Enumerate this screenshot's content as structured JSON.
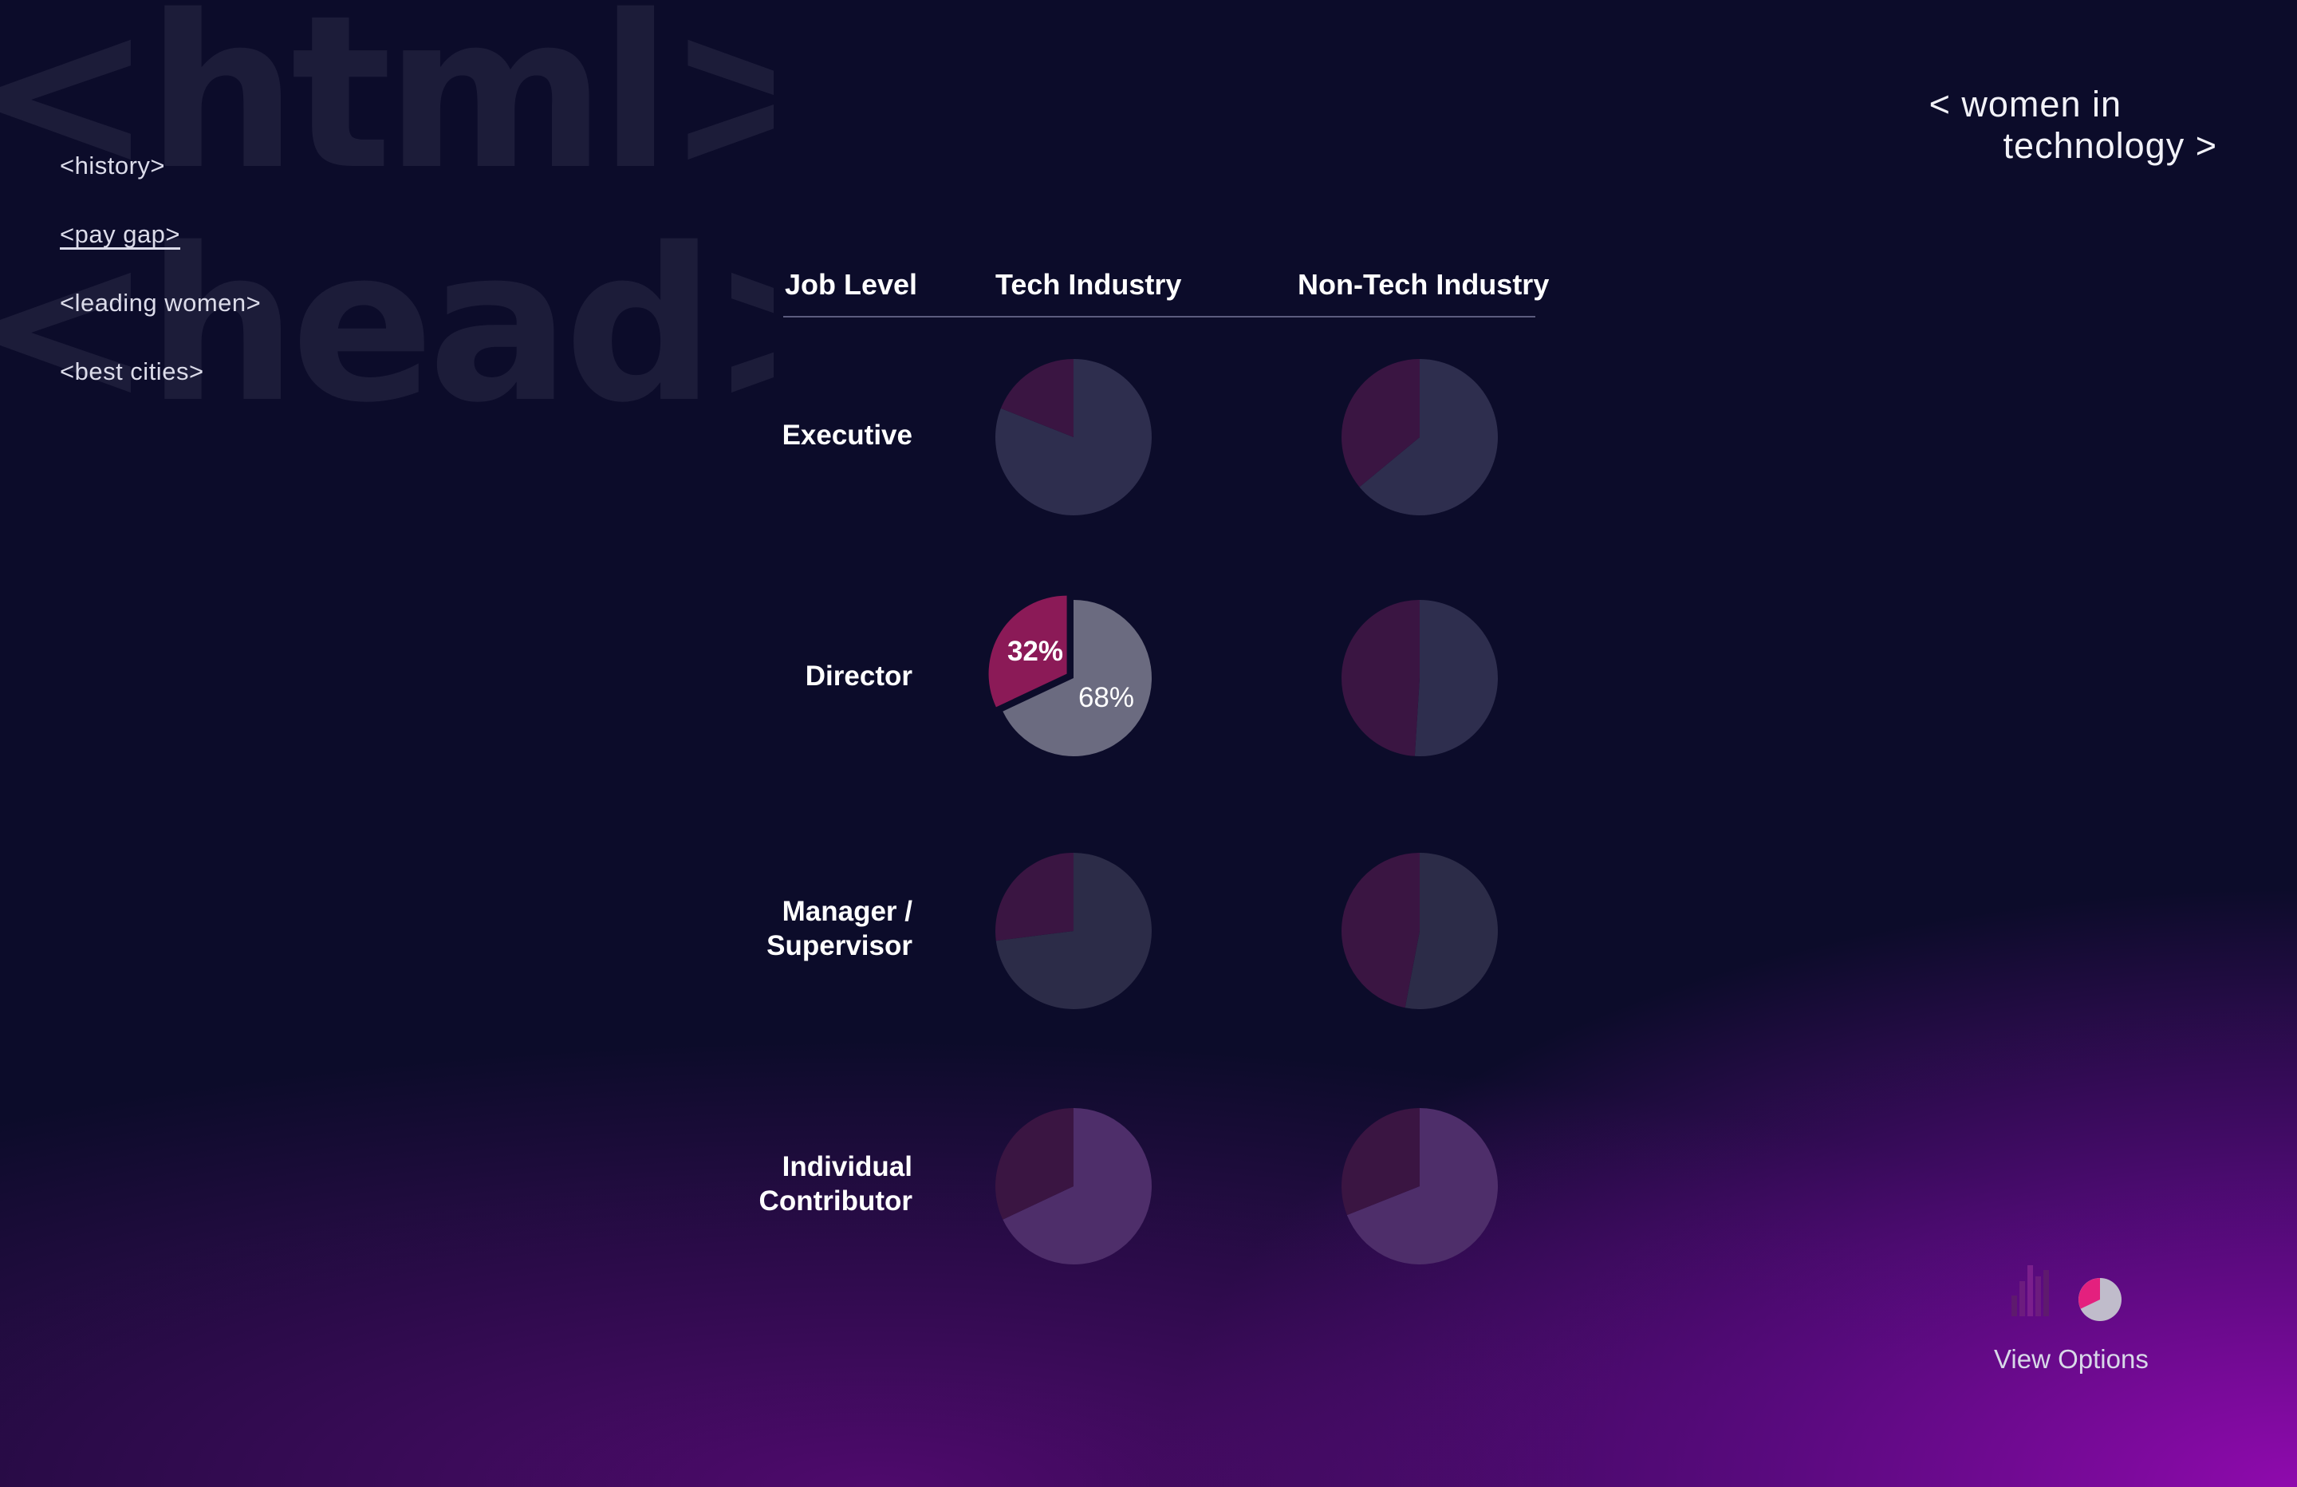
{
  "watermark": {
    "line1": "<html>",
    "line2": "<head>"
  },
  "nav": {
    "items": [
      {
        "label": "<history>"
      },
      {
        "label": "<pay gap>"
      },
      {
        "label": "<leading women>"
      },
      {
        "label": "<best cities>"
      }
    ]
  },
  "brand": {
    "line1": "< women in",
    "line2": "technology >"
  },
  "chart_data": {
    "type": "pie",
    "columns": [
      "Job Level",
      "Tech Industry",
      "Non-Tech Industry"
    ],
    "rows": [
      {
        "label_lines": [
          "Executive"
        ],
        "tech": 19,
        "nontech": 36
      },
      {
        "label_lines": [
          "Director"
        ],
        "tech": 32,
        "nontech": 49,
        "highlighted": true
      },
      {
        "label_lines": [
          "Manager /",
          "Supervisor"
        ],
        "tech": 27,
        "nontech": 47
      },
      {
        "label_lines": [
          "Individual",
          "Contributor"
        ],
        "tech": 32,
        "nontech": 31
      }
    ],
    "highlight_labels": {
      "women": "32%",
      "men": "68%"
    },
    "colors": {
      "women_dim": "#3a1542",
      "women_highlight": "#8b1a57",
      "men_highlight": "#6b6b80",
      "men_row": [
        "#2e2e4e",
        "#2e2e4e",
        "#2c2c48",
        "#4e2e6a"
      ]
    }
  },
  "view_options": {
    "label": "View Options"
  },
  "icons": {
    "bar": "bar-chart-icon",
    "pie": "pie-chart-icon"
  }
}
